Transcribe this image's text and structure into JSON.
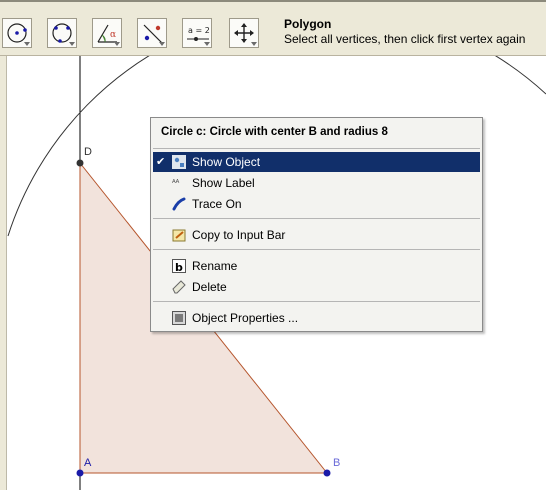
{
  "toolbar": {
    "tools": [
      {
        "icon": "circle-center-point-icon"
      },
      {
        "icon": "circle-three-points-icon"
      },
      {
        "icon": "angle-icon"
      },
      {
        "icon": "reflect-point-icon"
      },
      {
        "icon": "slider-icon",
        "text": "a = 2"
      },
      {
        "icon": "move-graphics-view-icon"
      }
    ],
    "active_tool_name": "Polygon",
    "active_tool_hint": "Select all vertices, then click first vertex again"
  },
  "points": {
    "A": "A",
    "B": "B",
    "D": "D"
  },
  "context_menu": {
    "title": "Circle c: Circle with center B and radius 8",
    "items": [
      {
        "label": "Show Object",
        "checked": true,
        "selected": true,
        "icon": "show-object-icon"
      },
      {
        "label": "Show Label",
        "checked": false,
        "icon": "show-label-icon"
      },
      {
        "label": "Trace On",
        "checked": false,
        "icon": "trace-icon"
      },
      {
        "label": "Copy to Input Bar",
        "checked": false,
        "icon": "copy-to-input-bar-icon"
      },
      {
        "label": "Rename",
        "checked": false,
        "icon": "rename-icon"
      },
      {
        "label": "Delete",
        "checked": false,
        "icon": "delete-icon"
      },
      {
        "label": "Object Properties ...",
        "checked": false,
        "icon": "object-properties-icon"
      }
    ],
    "checkmark": "✔"
  },
  "colors": {
    "polygon_fill": "#f2e3dc",
    "polygon_stroke": "#b5542b",
    "point_color": "#1a1aa8",
    "circle_color": "#333333",
    "menu_selected": "#112f6a"
  }
}
